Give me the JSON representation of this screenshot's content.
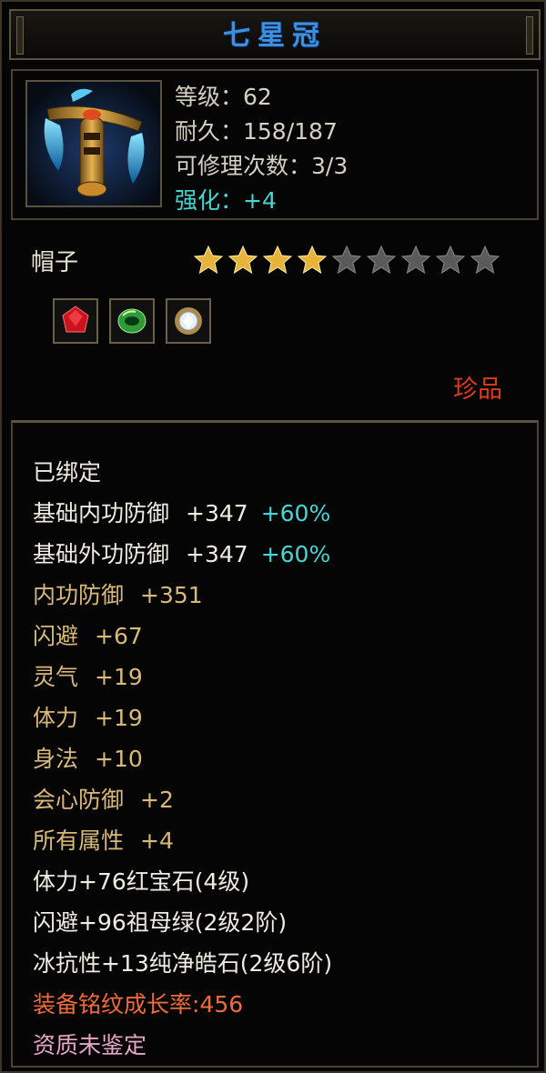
{
  "item": {
    "name": "七星冠",
    "stats": [
      {
        "text": "等级：62",
        "style": "normal"
      },
      {
        "text": "耐久：158/187",
        "style": "normal"
      },
      {
        "text": "可修理次数：3/3",
        "style": "normal"
      },
      {
        "text": "强化：+4",
        "style": "cyan"
      }
    ],
    "type": "帽子",
    "stars": {
      "filled": 4,
      "total": 9
    },
    "gems": [
      "ruby-gem-icon",
      "emerald-gem-icon",
      "diamond-gem-icon"
    ],
    "rarity": "珍品"
  },
  "attributes": {
    "bound": "已绑定",
    "base": [
      {
        "name": "基础内功防御",
        "value": "+347",
        "bonus": "+60%"
      },
      {
        "name": "基础外功防御",
        "value": "+347",
        "bonus": "+60%"
      }
    ],
    "extra": [
      {
        "name": "内功防御",
        "value": "+351"
      },
      {
        "name": "闪避",
        "value": "+67"
      },
      {
        "name": "灵气",
        "value": "+19"
      },
      {
        "name": "体力",
        "value": "+19"
      },
      {
        "name": "身法",
        "value": "+10"
      },
      {
        "name": "会心防御",
        "value": "+2"
      },
      {
        "name": "所有属性",
        "value": "+4"
      }
    ],
    "sockets": [
      "体力+76红宝石(4级)",
      "闪避+96祖母绿(2级2阶)",
      "冰抗性+13纯净皓石(2级6阶)"
    ],
    "growth": "装备铭纹成长率:456",
    "quality": "资质未鉴定"
  },
  "colors": {
    "title": "#3d8fe0",
    "cyan": "#44d6d0",
    "gold": "#d9b97a",
    "rarity": "#e03a1e",
    "growth": "#f06a3a",
    "quality": "#e6a6c8"
  }
}
